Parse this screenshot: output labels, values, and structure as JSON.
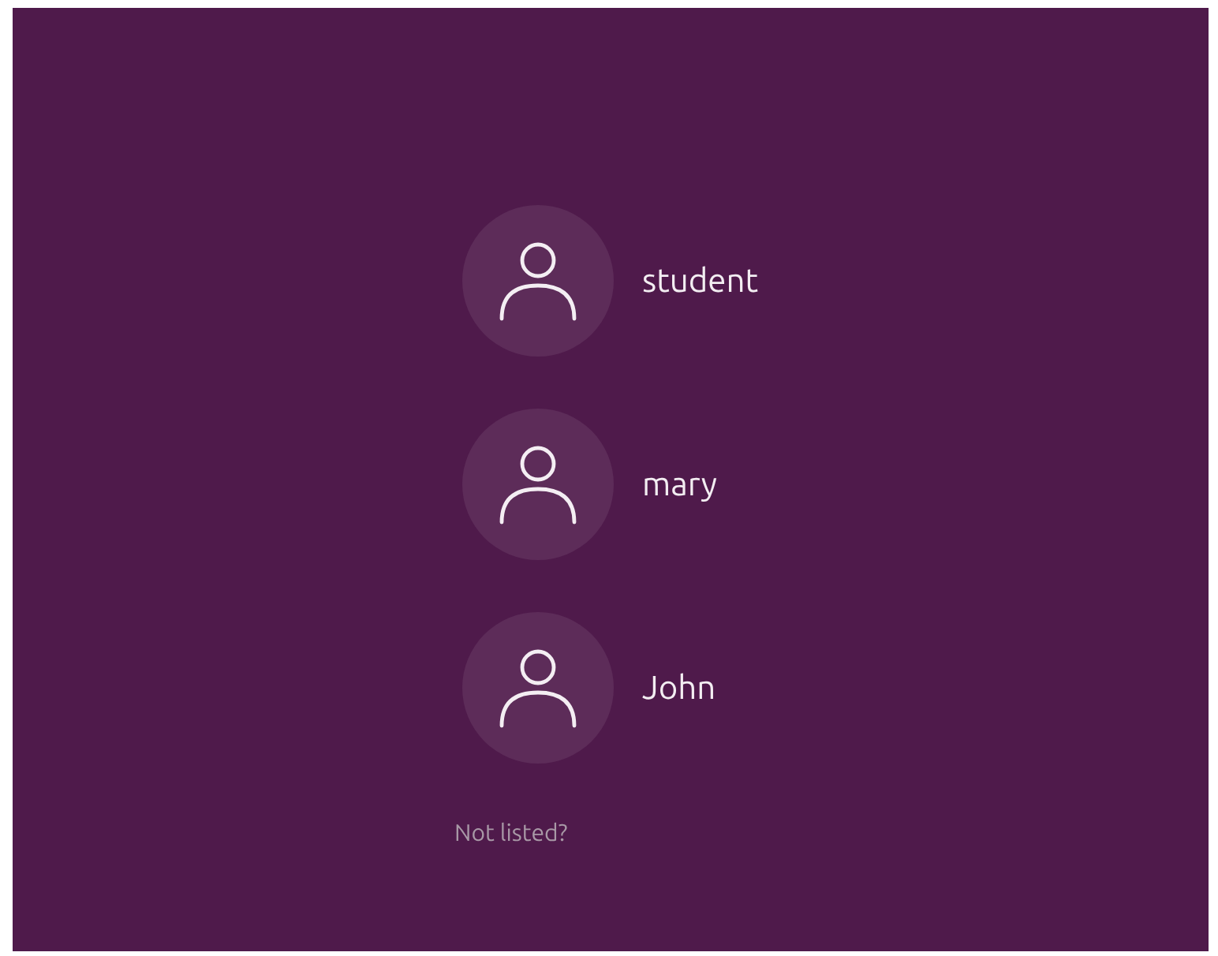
{
  "users": [
    {
      "name": "student"
    },
    {
      "name": "mary"
    },
    {
      "name": "John"
    }
  ],
  "not_listed_link": "Not listed?"
}
